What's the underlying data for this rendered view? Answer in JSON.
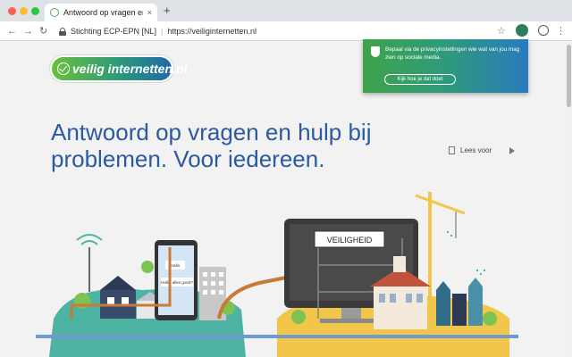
{
  "browser": {
    "tab_title": "Antwoord op vragen en hulp bij",
    "tab_close": "×",
    "new_tab": "+",
    "org": "Stichting ECP-EPN [NL]",
    "separator": "|",
    "url": "https://veiliginternetten.nl",
    "back": "←",
    "forward": "→",
    "reload": "↻",
    "bookmark": "☆",
    "menu": "⋮"
  },
  "logo": {
    "text": "veilig internetten.nl"
  },
  "headline": {
    "line1": "Antwoord op vragen en hulp bij",
    "line2": "problemen. Voor iedereen."
  },
  "read_aloud": {
    "label": "Lees voor"
  },
  "notice": {
    "text": "Bepaal via de privacyinstellingen wie wat van jou mag zien op sociale media.",
    "button": "Kijk hoe je dat doet"
  },
  "illustration": {
    "sign": "VEILIGHEID",
    "bubble1": "Hallo",
    "bubble2": "Hallo, alles goed?"
  },
  "colors": {
    "headline": "#2b5aa0",
    "accent_green": "#3fa34a",
    "accent_blue": "#2a7bbf",
    "pipe": "#c77a3a"
  }
}
